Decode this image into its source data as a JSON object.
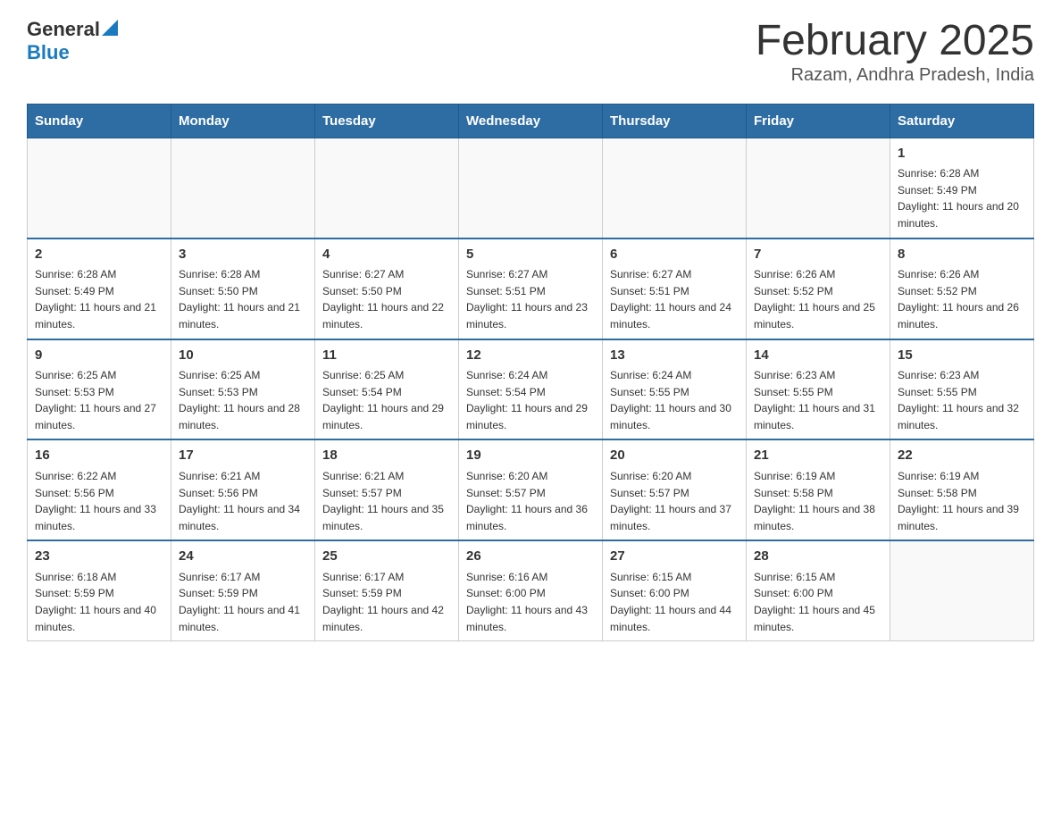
{
  "header": {
    "logo_general": "General",
    "logo_blue": "Blue",
    "title": "February 2025",
    "subtitle": "Razam, Andhra Pradesh, India"
  },
  "days_of_week": [
    "Sunday",
    "Monday",
    "Tuesday",
    "Wednesday",
    "Thursday",
    "Friday",
    "Saturday"
  ],
  "weeks": [
    {
      "days": [
        {
          "number": "",
          "info": ""
        },
        {
          "number": "",
          "info": ""
        },
        {
          "number": "",
          "info": ""
        },
        {
          "number": "",
          "info": ""
        },
        {
          "number": "",
          "info": ""
        },
        {
          "number": "",
          "info": ""
        },
        {
          "number": "1",
          "info": "Sunrise: 6:28 AM\nSunset: 5:49 PM\nDaylight: 11 hours and 20 minutes."
        }
      ]
    },
    {
      "days": [
        {
          "number": "2",
          "info": "Sunrise: 6:28 AM\nSunset: 5:49 PM\nDaylight: 11 hours and 21 minutes."
        },
        {
          "number": "3",
          "info": "Sunrise: 6:28 AM\nSunset: 5:50 PM\nDaylight: 11 hours and 21 minutes."
        },
        {
          "number": "4",
          "info": "Sunrise: 6:27 AM\nSunset: 5:50 PM\nDaylight: 11 hours and 22 minutes."
        },
        {
          "number": "5",
          "info": "Sunrise: 6:27 AM\nSunset: 5:51 PM\nDaylight: 11 hours and 23 minutes."
        },
        {
          "number": "6",
          "info": "Sunrise: 6:27 AM\nSunset: 5:51 PM\nDaylight: 11 hours and 24 minutes."
        },
        {
          "number": "7",
          "info": "Sunrise: 6:26 AM\nSunset: 5:52 PM\nDaylight: 11 hours and 25 minutes."
        },
        {
          "number": "8",
          "info": "Sunrise: 6:26 AM\nSunset: 5:52 PM\nDaylight: 11 hours and 26 minutes."
        }
      ]
    },
    {
      "days": [
        {
          "number": "9",
          "info": "Sunrise: 6:25 AM\nSunset: 5:53 PM\nDaylight: 11 hours and 27 minutes."
        },
        {
          "number": "10",
          "info": "Sunrise: 6:25 AM\nSunset: 5:53 PM\nDaylight: 11 hours and 28 minutes."
        },
        {
          "number": "11",
          "info": "Sunrise: 6:25 AM\nSunset: 5:54 PM\nDaylight: 11 hours and 29 minutes."
        },
        {
          "number": "12",
          "info": "Sunrise: 6:24 AM\nSunset: 5:54 PM\nDaylight: 11 hours and 29 minutes."
        },
        {
          "number": "13",
          "info": "Sunrise: 6:24 AM\nSunset: 5:55 PM\nDaylight: 11 hours and 30 minutes."
        },
        {
          "number": "14",
          "info": "Sunrise: 6:23 AM\nSunset: 5:55 PM\nDaylight: 11 hours and 31 minutes."
        },
        {
          "number": "15",
          "info": "Sunrise: 6:23 AM\nSunset: 5:55 PM\nDaylight: 11 hours and 32 minutes."
        }
      ]
    },
    {
      "days": [
        {
          "number": "16",
          "info": "Sunrise: 6:22 AM\nSunset: 5:56 PM\nDaylight: 11 hours and 33 minutes."
        },
        {
          "number": "17",
          "info": "Sunrise: 6:21 AM\nSunset: 5:56 PM\nDaylight: 11 hours and 34 minutes."
        },
        {
          "number": "18",
          "info": "Sunrise: 6:21 AM\nSunset: 5:57 PM\nDaylight: 11 hours and 35 minutes."
        },
        {
          "number": "19",
          "info": "Sunrise: 6:20 AM\nSunset: 5:57 PM\nDaylight: 11 hours and 36 minutes."
        },
        {
          "number": "20",
          "info": "Sunrise: 6:20 AM\nSunset: 5:57 PM\nDaylight: 11 hours and 37 minutes."
        },
        {
          "number": "21",
          "info": "Sunrise: 6:19 AM\nSunset: 5:58 PM\nDaylight: 11 hours and 38 minutes."
        },
        {
          "number": "22",
          "info": "Sunrise: 6:19 AM\nSunset: 5:58 PM\nDaylight: 11 hours and 39 minutes."
        }
      ]
    },
    {
      "days": [
        {
          "number": "23",
          "info": "Sunrise: 6:18 AM\nSunset: 5:59 PM\nDaylight: 11 hours and 40 minutes."
        },
        {
          "number": "24",
          "info": "Sunrise: 6:17 AM\nSunset: 5:59 PM\nDaylight: 11 hours and 41 minutes."
        },
        {
          "number": "25",
          "info": "Sunrise: 6:17 AM\nSunset: 5:59 PM\nDaylight: 11 hours and 42 minutes."
        },
        {
          "number": "26",
          "info": "Sunrise: 6:16 AM\nSunset: 6:00 PM\nDaylight: 11 hours and 43 minutes."
        },
        {
          "number": "27",
          "info": "Sunrise: 6:15 AM\nSunset: 6:00 PM\nDaylight: 11 hours and 44 minutes."
        },
        {
          "number": "28",
          "info": "Sunrise: 6:15 AM\nSunset: 6:00 PM\nDaylight: 11 hours and 45 minutes."
        },
        {
          "number": "",
          "info": ""
        }
      ]
    }
  ]
}
